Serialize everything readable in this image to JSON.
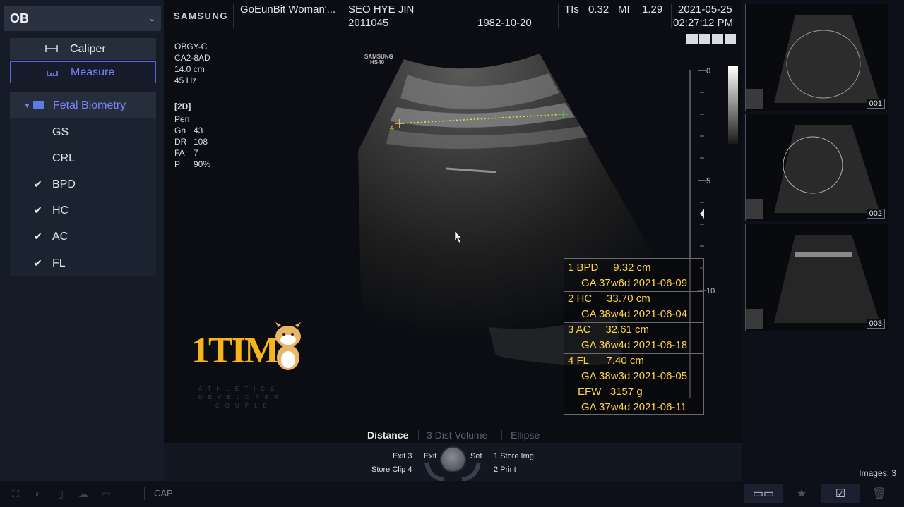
{
  "mode": {
    "label": "OB"
  },
  "tools": {
    "caliper_label": "Caliper",
    "measure_label": "Measure"
  },
  "tree": {
    "group_label": "Fetal Biometry",
    "items": [
      {
        "label": "GS",
        "checked": false
      },
      {
        "label": "CRL",
        "checked": false
      },
      {
        "label": "BPD",
        "checked": true
      },
      {
        "label": "HC",
        "checked": true
      },
      {
        "label": "AC",
        "checked": true
      },
      {
        "label": "FL",
        "checked": true
      }
    ],
    "check_glyph": "✔"
  },
  "header": {
    "brand": "SAMSUNG",
    "institution": "GoEunBit Woman'...",
    "patient_name": "SEO HYE JIN",
    "patient_id": "2011045",
    "birth_date": "1982-10-20",
    "tis_label": "TIs",
    "tis_value": "0.32",
    "mi_label": "MI",
    "mi_value": "1.29",
    "date": "2021-05-25",
    "time": "02:27:12 PM"
  },
  "params": {
    "preset": "OBGY-C",
    "probe": "CA2-8AD",
    "depth": "14.0 cm",
    "frame_rate": "45 Hz",
    "mode": "[2D]",
    "freq": "Pen",
    "gain_label": "Gn",
    "gain_value": "43",
    "dr_label": "DR",
    "dr_value": "108",
    "fa_label": "FA",
    "fa_value": "7",
    "power_label": "P",
    "power_value": "90%"
  },
  "image": {
    "device_brand": "SAMSUNG",
    "device_model": "HS40",
    "caliper_marker": "4",
    "scale_labels": [
      "0",
      "5",
      "10"
    ]
  },
  "measurements": {
    "rows": [
      {
        "text": "1 BPD     9.32 cm"
      },
      {
        "text": "GA 37w6d 2021-06-09"
      },
      {
        "text": "2 HC     33.70 cm"
      },
      {
        "text": "GA 38w4d 2021-06-04"
      },
      {
        "text": "3 AC     32.61 cm"
      },
      {
        "text": "GA 36w4d 2021-06-18"
      },
      {
        "text": "4 FL      7.40 cm"
      },
      {
        "text": "GA 38w3d 2021-06-05"
      },
      {
        "text": "EFW   3157 g"
      },
      {
        "text": "GA 37w4d 2021-06-11"
      }
    ]
  },
  "bottom_tabs": {
    "distance": "Distance",
    "dist_volume": "3 Dist Volume",
    "ellipse": "Ellipse"
  },
  "controls": {
    "exit3": "Exit 3",
    "store_clip": "Store Clip 4",
    "exit": "Exit",
    "set": "Set",
    "store_img": "1 Store Img",
    "print": "2 Print"
  },
  "status": {
    "cap": "CAP"
  },
  "thumbnails": [
    {
      "num": "001"
    },
    {
      "num": "002"
    },
    {
      "num": "003"
    }
  ],
  "images_count": "Images: 3",
  "logo": {
    "text": "1TIM",
    "tagline": [
      "ATHLETIC&",
      "DEVELOPER",
      "COUPLE"
    ]
  },
  "colors": {
    "accent": "#7b83ff",
    "measurement": "#ffd24a",
    "logo": "#f5b51b"
  }
}
